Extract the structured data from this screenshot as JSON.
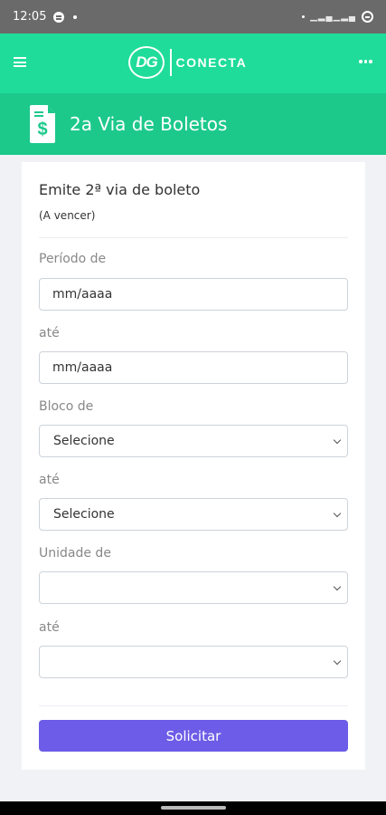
{
  "status_bar": {
    "time": "12:05"
  },
  "app_bar": {
    "logo_mark": "DG",
    "logo_word": "CONECTA"
  },
  "page": {
    "title": "2a Via de Boletos"
  },
  "form": {
    "heading": "Emite 2ª via de boleto",
    "subheading": "(A vencer)",
    "periodo_de_label": "Período de",
    "periodo_de_placeholder": "mm/aaaa",
    "periodo_ate_label": "até",
    "periodo_ate_placeholder": "mm/aaaa",
    "bloco_de_label": "Bloco de",
    "bloco_de_value": "Selecione",
    "bloco_ate_label": "até",
    "bloco_ate_value": "Selecione",
    "unidade_de_label": "Unidade de",
    "unidade_de_value": "",
    "unidade_ate_label": "até",
    "unidade_ate_value": "",
    "submit_label": "Solicitar"
  },
  "colors": {
    "app_bar": "#1fdc9a",
    "title_bar": "#1cc98b",
    "primary_button": "#6c5ce7",
    "status_bar": "#6a6a6a"
  },
  "icons": [
    "menu-icon",
    "more-icon",
    "document-dollar-icon",
    "chevron-down-icon"
  ]
}
